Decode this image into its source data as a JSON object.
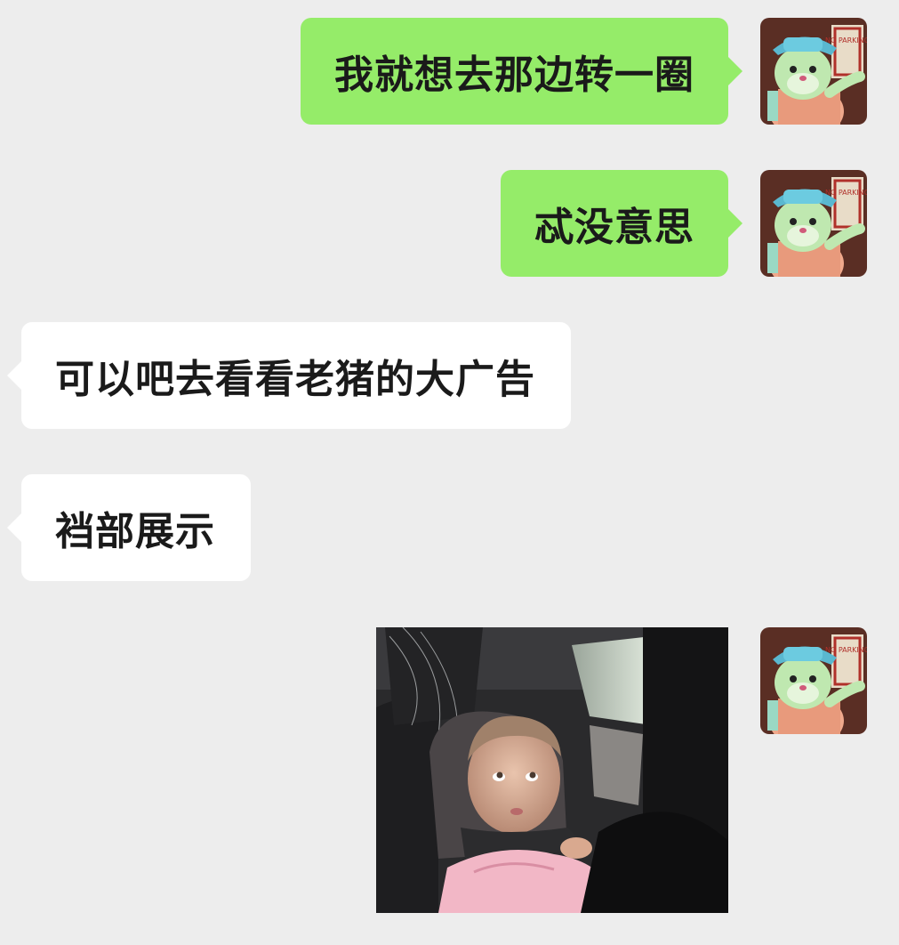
{
  "messages": [
    {
      "direction": "outgoing",
      "type": "text",
      "text": "我就想去那边转一圈"
    },
    {
      "direction": "outgoing",
      "type": "text",
      "text": "忒没意思"
    },
    {
      "direction": "incoming",
      "type": "text",
      "text": "可以吧去看看老猪的大广告"
    },
    {
      "direction": "incoming",
      "type": "text",
      "text": "裆部展示"
    },
    {
      "direction": "outgoing",
      "type": "image",
      "image_description": "toddler-in-car-seat-photo"
    }
  ],
  "avatar": {
    "icon": "bear-mascot-avatar",
    "sign_text": "NO PARKING"
  },
  "colors": {
    "background": "#ededed",
    "outgoing_bubble": "#95ec69",
    "incoming_bubble": "#ffffff",
    "text": "#1a1a1a"
  }
}
